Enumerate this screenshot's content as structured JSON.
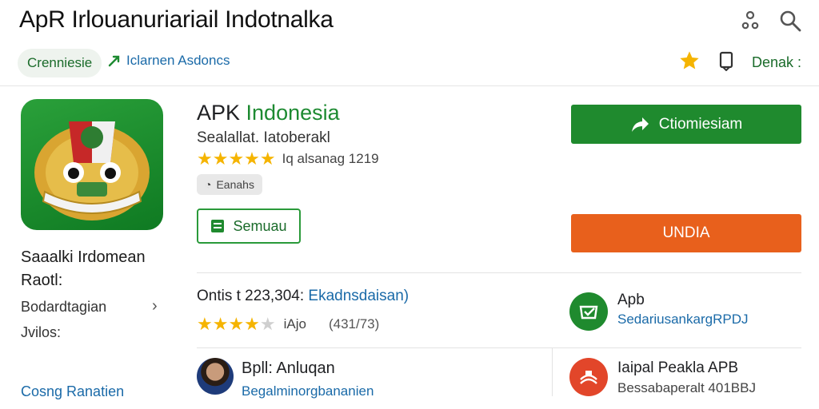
{
  "header": {
    "title": "ApR Irlouanuriariail Indotnalka",
    "icons": [
      "share-icon",
      "search-icon"
    ]
  },
  "subbar": {
    "chip_label": "Crenniesie",
    "link_label": "Iclarnen Asdoncs",
    "right_label": "Denak :"
  },
  "app": {
    "name_prefix": "APK ",
    "name_highlight": "Indonesia",
    "developer": "Sealallat. Iatoberakl",
    "rating_meta": "Iq alsanag 1219",
    "badge_label": "Eanahs",
    "outline_button": "Semuau"
  },
  "actions": {
    "primary_label": "Ctiomiesiam",
    "secondary_label": "UNDIA"
  },
  "left_panel": {
    "line1": "Saaalki Irdomean",
    "line2": "Raotl:",
    "nav_item": "Bodardtagian",
    "line4": "Jvilos:",
    "bottom_link": "Cosng Ranatien"
  },
  "stats": {
    "online_prefix": "Ontis t 223,304: ",
    "online_link": "Ekadnsdaisan)",
    "rating_label": "iAjo",
    "rating_count": "(431/73)"
  },
  "review": {
    "name": "Bpll: Anluqan",
    "sub": "Begalminorgbananien"
  },
  "related": [
    {
      "title": "Apb",
      "sub": "SedariusankargRPDJ",
      "color": "#1f8a2e"
    },
    {
      "title": "Iaipal Peakla APB",
      "sub": "Bessabaperalt 401BBJ",
      "color": "#e2462a"
    }
  ],
  "colors": {
    "accent_green": "#1f8a2e",
    "accent_orange": "#e8601c",
    "link_blue": "#1a6aa8",
    "star_gold": "#f5b400"
  }
}
